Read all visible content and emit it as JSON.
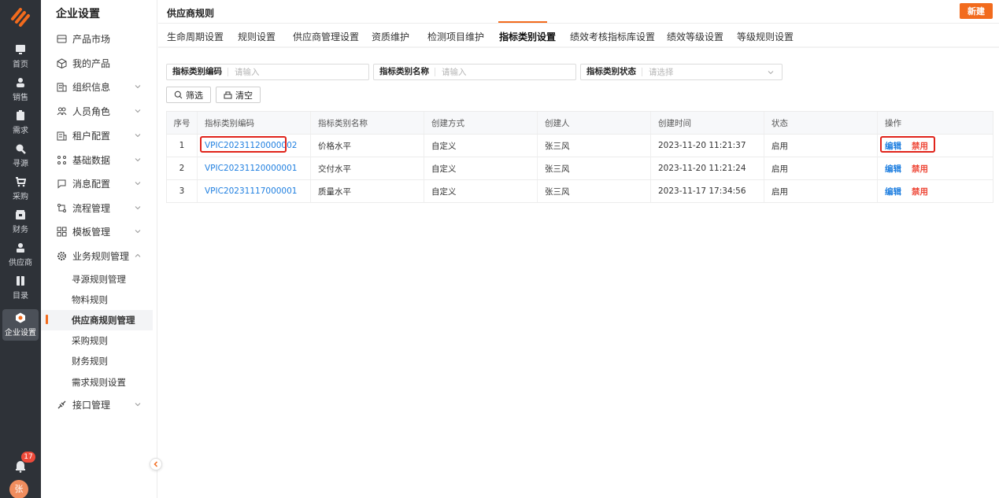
{
  "rail": {
    "items": [
      {
        "label": "首页"
      },
      {
        "label": "销售"
      },
      {
        "label": "需求"
      },
      {
        "label": "寻源"
      },
      {
        "label": "采购"
      },
      {
        "label": "财务"
      },
      {
        "label": "供应商"
      },
      {
        "label": "目录"
      },
      {
        "label": "企业设置"
      }
    ],
    "notification_count": "17",
    "avatar_text": "张"
  },
  "menu": {
    "title": "企业设置",
    "items": [
      {
        "label": "产品市场"
      },
      {
        "label": "我的产品"
      },
      {
        "label": "组织信息"
      },
      {
        "label": "人员角色"
      },
      {
        "label": "租户配置"
      },
      {
        "label": "基础数据"
      },
      {
        "label": "消息配置"
      },
      {
        "label": "流程管理"
      },
      {
        "label": "模板管理"
      },
      {
        "label": "业务规则管理"
      },
      {
        "label": "接口管理"
      }
    ],
    "sub_items": [
      {
        "label": "寻源规则管理"
      },
      {
        "label": "物料规则"
      },
      {
        "label": "供应商规则管理"
      },
      {
        "label": "采购规则"
      },
      {
        "label": "财务规则"
      },
      {
        "label": "需求规则设置"
      }
    ]
  },
  "header": {
    "title": "供应商规则",
    "new_button": "新建"
  },
  "tabs": [
    {
      "label": "生命周期设置"
    },
    {
      "label": "规则设置"
    },
    {
      "label": "供应商管理设置"
    },
    {
      "label": "资质维护"
    },
    {
      "label": "检测项目维护"
    },
    {
      "label": "指标类别设置"
    },
    {
      "label": "绩效考核指标库设置"
    },
    {
      "label": "绩效等级设置"
    },
    {
      "label": "等级规则设置"
    }
  ],
  "filters": {
    "code": {
      "label": "指标类别编码",
      "placeholder": "请输入"
    },
    "name": {
      "label": "指标类别名称",
      "placeholder": "请输入"
    },
    "status": {
      "label": "指标类别状态",
      "placeholder": "请选择"
    }
  },
  "buttons": {
    "filter": "筛选",
    "clear": "清空"
  },
  "table": {
    "columns": [
      "序号",
      "指标类别编码",
      "指标类别名称",
      "创建方式",
      "创建人",
      "创建时间",
      "状态",
      "操作"
    ],
    "rows": [
      {
        "index": "1",
        "code": "VPIC20231120000002",
        "name": "价格水平",
        "method": "自定义",
        "creator": "张三风",
        "time": "2023-11-20 11:21:37",
        "status": "启用",
        "edit": "编辑",
        "disable": "禁用"
      },
      {
        "index": "2",
        "code": "VPIC20231120000001",
        "name": "交付水平",
        "method": "自定义",
        "creator": "张三风",
        "time": "2023-11-20 11:21:24",
        "status": "启用",
        "edit": "编辑",
        "disable": "禁用"
      },
      {
        "index": "3",
        "code": "VPIC20231117000001",
        "name": "质量水平",
        "method": "自定义",
        "creator": "张三风",
        "time": "2023-11-17 17:34:56",
        "status": "启用",
        "edit": "编辑",
        "disable": "禁用"
      }
    ]
  },
  "colors": {
    "accent": "#f26b1d",
    "link": "#1f7fe0",
    "danger": "#ee4a3a",
    "rail_bg": "#2e3238"
  }
}
